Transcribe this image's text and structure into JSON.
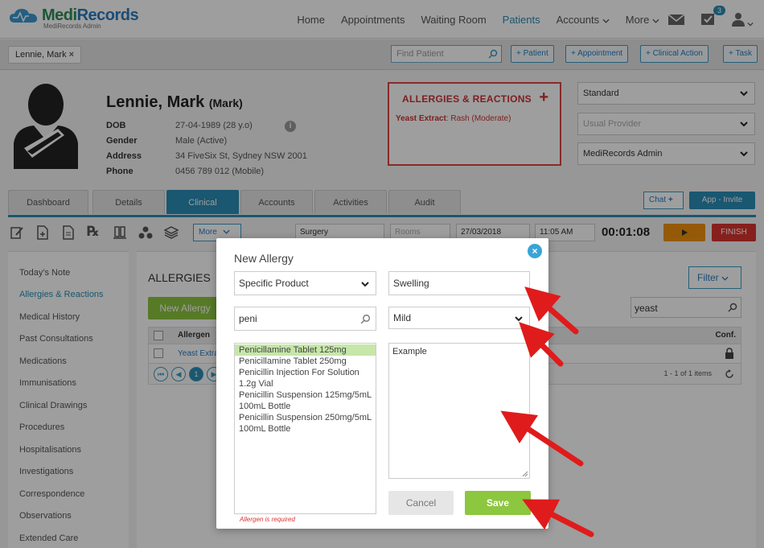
{
  "brand": {
    "name_a": "Medi",
    "name_b": "Records",
    "sub": "MediRecords Admin"
  },
  "nav": {
    "items": [
      "Home",
      "Appointments",
      "Waiting Room",
      "Patients",
      "Accounts",
      "More"
    ],
    "active": "Patients",
    "task_badge": "3"
  },
  "tabbar": {
    "patient_chip": "Lennie, Mark",
    "find_placeholder": "Find Patient",
    "buttons": [
      "+ Patient",
      "+ Appointment",
      "+ Clinical Action",
      "+ Task"
    ]
  },
  "patient": {
    "surname_given": "Lennie, Mark",
    "nickname": "(Mark)",
    "fields": [
      {
        "label": "DOB",
        "value": "27-04-1989 (28 y.o)"
      },
      {
        "label": "Gender",
        "value": "Male (Active)"
      },
      {
        "label": "Address",
        "value": "34 FiveSix St, Sydney NSW 2001"
      },
      {
        "label": "Phone",
        "value": "0456 789 012 (Mobile)"
      }
    ]
  },
  "allergies_box": {
    "title": "ALLERGIES & REACTIONS",
    "item_name": "Yeast Extract",
    "item_detail": ": Rash (Moderate)"
  },
  "header_selects": {
    "s1": "Standard",
    "s2": "Usual Provider",
    "s3": "MediRecords Admin"
  },
  "main_tabs": [
    "Dashboard",
    "Details",
    "Clinical",
    "Accounts",
    "Activities",
    "Audit"
  ],
  "active_tab": "Clinical",
  "chat_label": "Chat",
  "app_invite": "App - Invite",
  "toolbar": {
    "more": "More",
    "surgery": "Surgery",
    "rooms": "Rooms",
    "date": "27/03/2018",
    "time": "11:05 AM",
    "timer": "00:01:08",
    "finish": "FINISH"
  },
  "sidebar": [
    "Today's Note",
    "Allergies & Reactions",
    "Medical History",
    "Past Consultations",
    "Medications",
    "Immunisations",
    "Clinical Drawings",
    "Procedures",
    "Hospitalisations",
    "Investigations",
    "Correspondence",
    "Observations",
    "Extended Care"
  ],
  "sidebar_active": "Allergies & Reactions",
  "main": {
    "title": "ALLERGIES",
    "new_button": "New Allergy",
    "filter": "Filter",
    "search_value": "yeast",
    "col_allergen": "Allergen",
    "col_conf": "Conf.",
    "row_allergen": "Yeast Extra",
    "pager_page": "1",
    "pager_info": "1 - 1 of 1 items"
  },
  "modal": {
    "title": "New Allergy",
    "type_value": "Specific Product",
    "reaction_value": "Swelling",
    "search_value": "peni",
    "severity_value": "Mild",
    "notes_value": "Example",
    "options": [
      "Penicillamine Tablet 125mg",
      "Penicillamine Tablet 250mg",
      "Penicillin Injection For Solution 1.2g Vial",
      "Penicillin Suspension 125mg/5mL 100mL Bottle",
      "Penicillin Suspension 250mg/5mL 100mL Bottle"
    ],
    "required_msg": "Allergen is required",
    "cancel": "Cancel",
    "save": "Save"
  },
  "colors": {
    "accent": "#2b8db5",
    "green": "#8dc63f",
    "danger": "#d44444",
    "arrow": "#e01b1b"
  }
}
